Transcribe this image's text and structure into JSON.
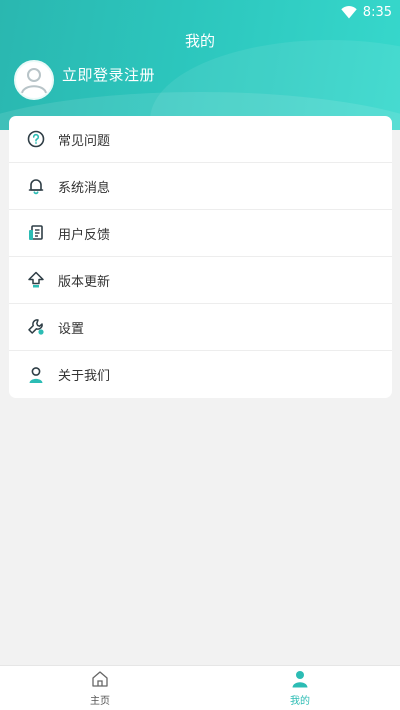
{
  "status_bar": {
    "time": "8:35",
    "wifi_icon": "wifi-icon"
  },
  "header": {
    "title": "我的",
    "login_text": "立即登录注册",
    "avatar_icon": "avatar-icon"
  },
  "menu": {
    "items": [
      {
        "label": "常见问题",
        "icon": "question-circle-icon"
      },
      {
        "label": "系统消息",
        "icon": "bell-icon"
      },
      {
        "label": "用户反馈",
        "icon": "feedback-document-icon"
      },
      {
        "label": "版本更新",
        "icon": "upload-arrow-icon"
      },
      {
        "label": "设置",
        "icon": "wrench-icon"
      },
      {
        "label": "关于我们",
        "icon": "person-icon"
      }
    ]
  },
  "tab_bar": {
    "tabs": [
      {
        "label": "主页",
        "icon": "home-icon",
        "active": false
      },
      {
        "label": "我的",
        "icon": "user-icon",
        "active": true
      }
    ]
  },
  "colors": {
    "accent": "#2cbcb4",
    "header_gradient_start": "#2ab7b0",
    "header_gradient_end": "#37d8cc",
    "icon_dark": "#2f3e46"
  }
}
